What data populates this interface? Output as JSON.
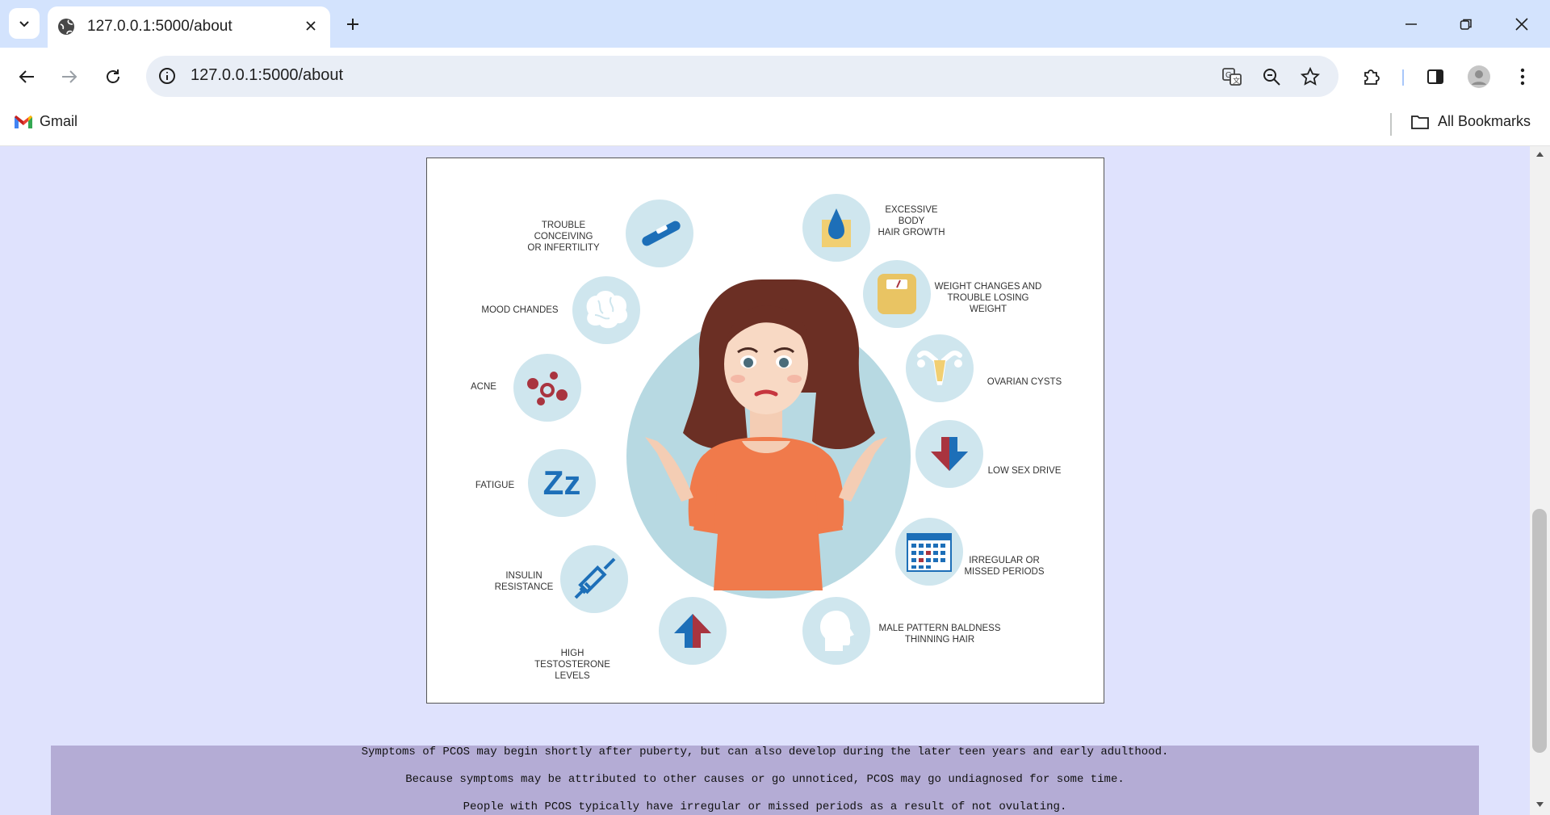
{
  "browser": {
    "tab_title": "127.0.0.1:5000/about",
    "url": "127.0.0.1:5000/about",
    "bookmarks": {
      "gmail": "Gmail",
      "all": "All Bookmarks"
    }
  },
  "infographic": {
    "labels": {
      "trouble_conceiving": "TROUBLE CONCEIVING\nOR INFERTILITY",
      "mood": "MOOD CHANDES",
      "acne": "ACNE",
      "fatigue": "FATIGUE",
      "insulin": "INSULIN\nRESISTANCE",
      "testosterone": "HIGH TESTOSTERONE\nLEVELS",
      "hair_growth": "EXCESSIVE BODY\nHAIR GROWTH",
      "weight": "WEIGHT CHANGES AND\nTROUBLE LOSING WEIGHT",
      "cysts": "OVARIAN CYSTS",
      "sex_drive": "LOW SEX DRIVE",
      "periods": "IRREGULAR OR\nMISSED PERIODS",
      "baldness": "MALE PATTERN BALDNESS\nTHINNING HAIR"
    },
    "zz_text": "Zz"
  },
  "content": {
    "para1": "Symptoms of PCOS may begin shortly after puberty, but can also develop during the later teen years and early adulthood.",
    "para2": "Because symptoms may be attributed to other causes or go unnoticed, PCOS may go undiagnosed for some time.",
    "para3": "People with PCOS typically have irregular or missed periods as a result of not ovulating."
  },
  "colors": {
    "page_bg": "#dfe2fd",
    "band_bg": "#b4acd5",
    "tabstrip": "#d3e3fd"
  }
}
